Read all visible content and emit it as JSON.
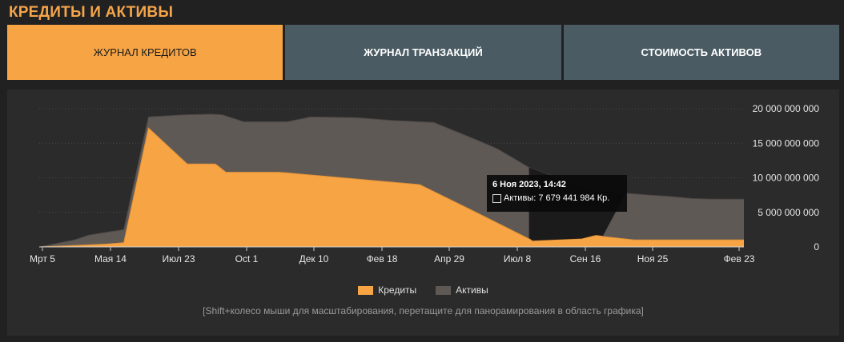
{
  "page": {
    "title": "КРЕДИТЫ И АКТИВЫ"
  },
  "tabs": [
    {
      "label": "ЖУРНАЛ КРЕДИТОВ",
      "active": true
    },
    {
      "label": "ЖУРНАЛ ТРАНЗАКЦИЙ",
      "active": false
    },
    {
      "label": "СТОИМОСТЬ АКТИВОВ",
      "active": false
    }
  ],
  "chart_data": {
    "type": "area",
    "x_tick_labels": [
      "Мрт 5",
      "Мая 14",
      "Июл 23",
      "Oct 1",
      "Дек 10",
      "Фев 18",
      "Апр 29",
      "Июл 8",
      "Сен 16",
      "Ноя 25",
      "Фев 23"
    ],
    "y_tick_labels": [
      "0",
      "5 000 000 000",
      "10 000 000 000",
      "15 000 000 000",
      "20 000 000 000"
    ],
    "ylim": [
      0,
      20000000000
    ],
    "y_axis_position": "right",
    "grid": "horizontal-dotted",
    "legend_position": "bottom-center",
    "colors": {
      "credits": "#f7a444",
      "assets": "#5f5956",
      "tooltip_region": "#111111",
      "grid": "#4a4a4a"
    },
    "series": [
      {
        "name": "Активы",
        "color": "#5f5956",
        "values": [
          0,
          1000000000,
          1700000000,
          2100000000,
          2500000000,
          18800000000,
          19100000000,
          19200000000,
          19100000000,
          18100000000,
          18100000000,
          18100000000,
          18800000000,
          18700000000,
          18300000000,
          18000000000,
          15500000000,
          14200000000,
          11500000000,
          8300000000,
          7700000000,
          7500000000,
          7300000000,
          7000000000,
          6900000000,
          6900000000
        ],
        "x_fraction": [
          0.0,
          0.05,
          0.07,
          0.095,
          0.12,
          0.155,
          0.205,
          0.245,
          0.26,
          0.29,
          0.34,
          0.352,
          0.385,
          0.45,
          0.5,
          0.56,
          0.62,
          0.65,
          0.695,
          0.78,
          0.84,
          0.865,
          0.895,
          0.925,
          0.96,
          1.0
        ]
      },
      {
        "name": "Кредиты",
        "color": "#f7a444",
        "values": [
          0,
          200000000,
          400000000,
          600000000,
          17200000000,
          12000000000,
          12000000000,
          10800000000,
          10800000000,
          10700000000,
          9000000000,
          5000000000,
          900000000,
          1200000000,
          1700000000,
          1500000000,
          1000000000,
          1000000000,
          1000000000
        ],
        "x_fraction": [
          0.0,
          0.05,
          0.095,
          0.12,
          0.155,
          0.21,
          0.25,
          0.265,
          0.34,
          0.352,
          0.54,
          0.62,
          0.7,
          0.77,
          0.79,
          0.8,
          0.844,
          0.9,
          1.0
        ]
      }
    ],
    "tooltip": {
      "title": "6 Ноя 2023, 14:42",
      "label": "Активы: 7 679 441 984 Кр."
    }
  },
  "legend": {
    "items": [
      {
        "label": "Кредиты",
        "color": "#f7a444"
      },
      {
        "label": "Активы",
        "color": "#5f5956"
      }
    ]
  },
  "hint": "[Shift+колесо мыши для масштабирования, перетащите для панорамирования в область графика]"
}
